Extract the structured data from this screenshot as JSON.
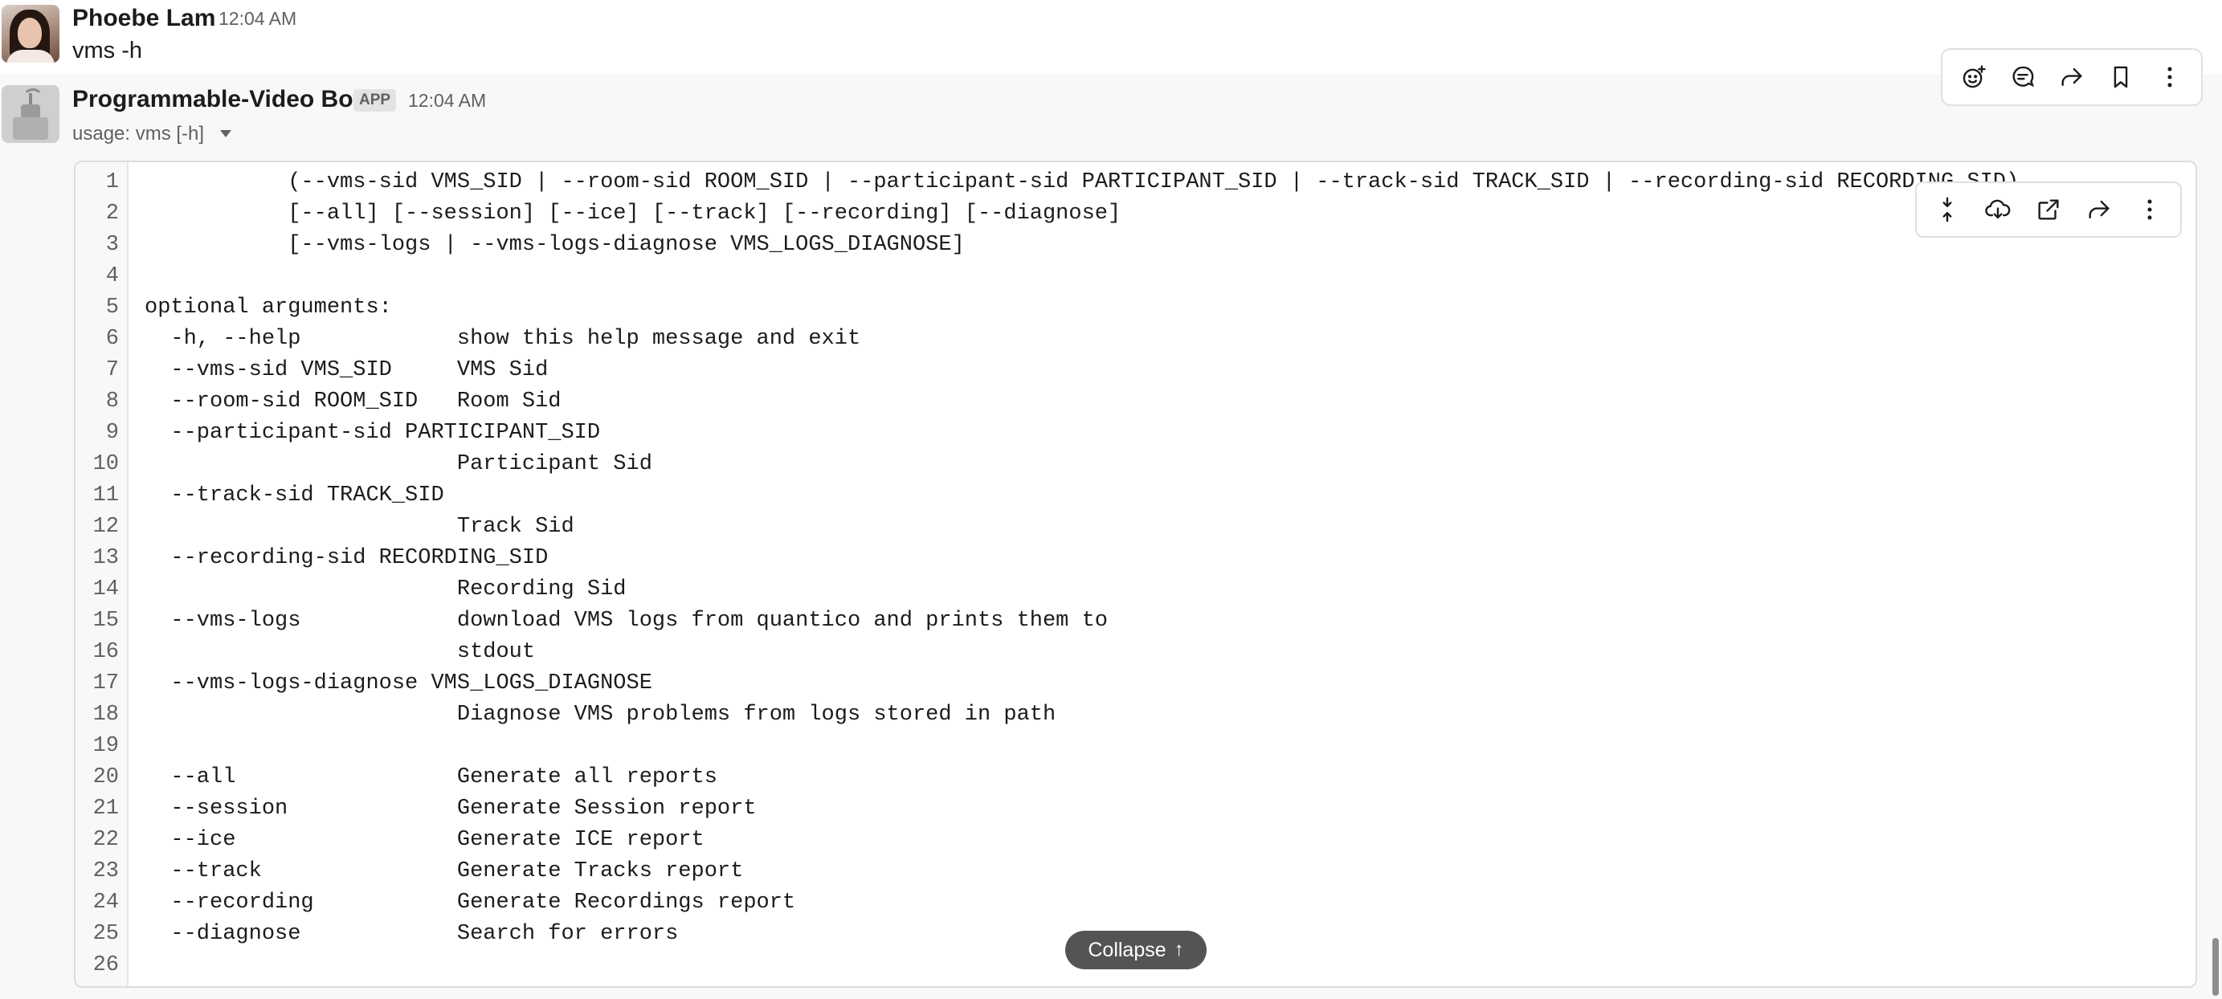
{
  "message1": {
    "author": "Phoebe Lam",
    "time": "12:04 AM",
    "text": "vms -h"
  },
  "message2": {
    "author": "Programmable-Video Bot",
    "badge": "APP",
    "time": "12:04 AM",
    "summary": "usage: vms [-h]"
  },
  "message_toolbar": {
    "icons": [
      "add-reaction-icon",
      "reply-in-thread-icon",
      "forward-icon",
      "bookmark-icon",
      "more-actions-icon"
    ]
  },
  "code_toolbar": {
    "icons": [
      "collapse-lines-icon",
      "download-icon",
      "open-external-icon",
      "share-icon",
      "more-options-icon"
    ]
  },
  "code_lines": [
    {
      "n": "1",
      "t": "           (--vms-sid VMS_SID | --room-sid ROOM_SID | --participant-sid PARTICIPANT_SID | --track-sid TRACK_SID | --recording-sid RECORDING_SID)"
    },
    {
      "n": "2",
      "t": "           [--all] [--session] [--ice] [--track] [--recording] [--diagnose]"
    },
    {
      "n": "3",
      "t": "           [--vms-logs | --vms-logs-diagnose VMS_LOGS_DIAGNOSE]"
    },
    {
      "n": "4",
      "t": ""
    },
    {
      "n": "5",
      "t": "optional arguments:"
    },
    {
      "n": "6",
      "t": "  -h, --help            show this help message and exit"
    },
    {
      "n": "7",
      "t": "  --vms-sid VMS_SID     VMS Sid"
    },
    {
      "n": "8",
      "t": "  --room-sid ROOM_SID   Room Sid"
    },
    {
      "n": "9",
      "t": "  --participant-sid PARTICIPANT_SID"
    },
    {
      "n": "10",
      "t": "                        Participant Sid"
    },
    {
      "n": "11",
      "t": "  --track-sid TRACK_SID"
    },
    {
      "n": "12",
      "t": "                        Track Sid"
    },
    {
      "n": "13",
      "t": "  --recording-sid RECORDING_SID"
    },
    {
      "n": "14",
      "t": "                        Recording Sid"
    },
    {
      "n": "15",
      "t": "  --vms-logs            download VMS logs from quantico and prints them to"
    },
    {
      "n": "16",
      "t": "                        stdout"
    },
    {
      "n": "17",
      "t": "  --vms-logs-diagnose VMS_LOGS_DIAGNOSE"
    },
    {
      "n": "18",
      "t": "                        Diagnose VMS problems from logs stored in path"
    },
    {
      "n": "19",
      "t": ""
    },
    {
      "n": "20",
      "t": "  --all                 Generate all reports"
    },
    {
      "n": "21",
      "t": "  --session             Generate Session report"
    },
    {
      "n": "22",
      "t": "  --ice                 Generate ICE report"
    },
    {
      "n": "23",
      "t": "  --track               Generate Tracks report"
    },
    {
      "n": "24",
      "t": "  --recording           Generate Recordings report"
    },
    {
      "n": "25",
      "t": "  --diagnose            Search for errors"
    },
    {
      "n": "26",
      "t": ""
    }
  ],
  "collapse_label": "Collapse",
  "collapse_arrow": "↑"
}
